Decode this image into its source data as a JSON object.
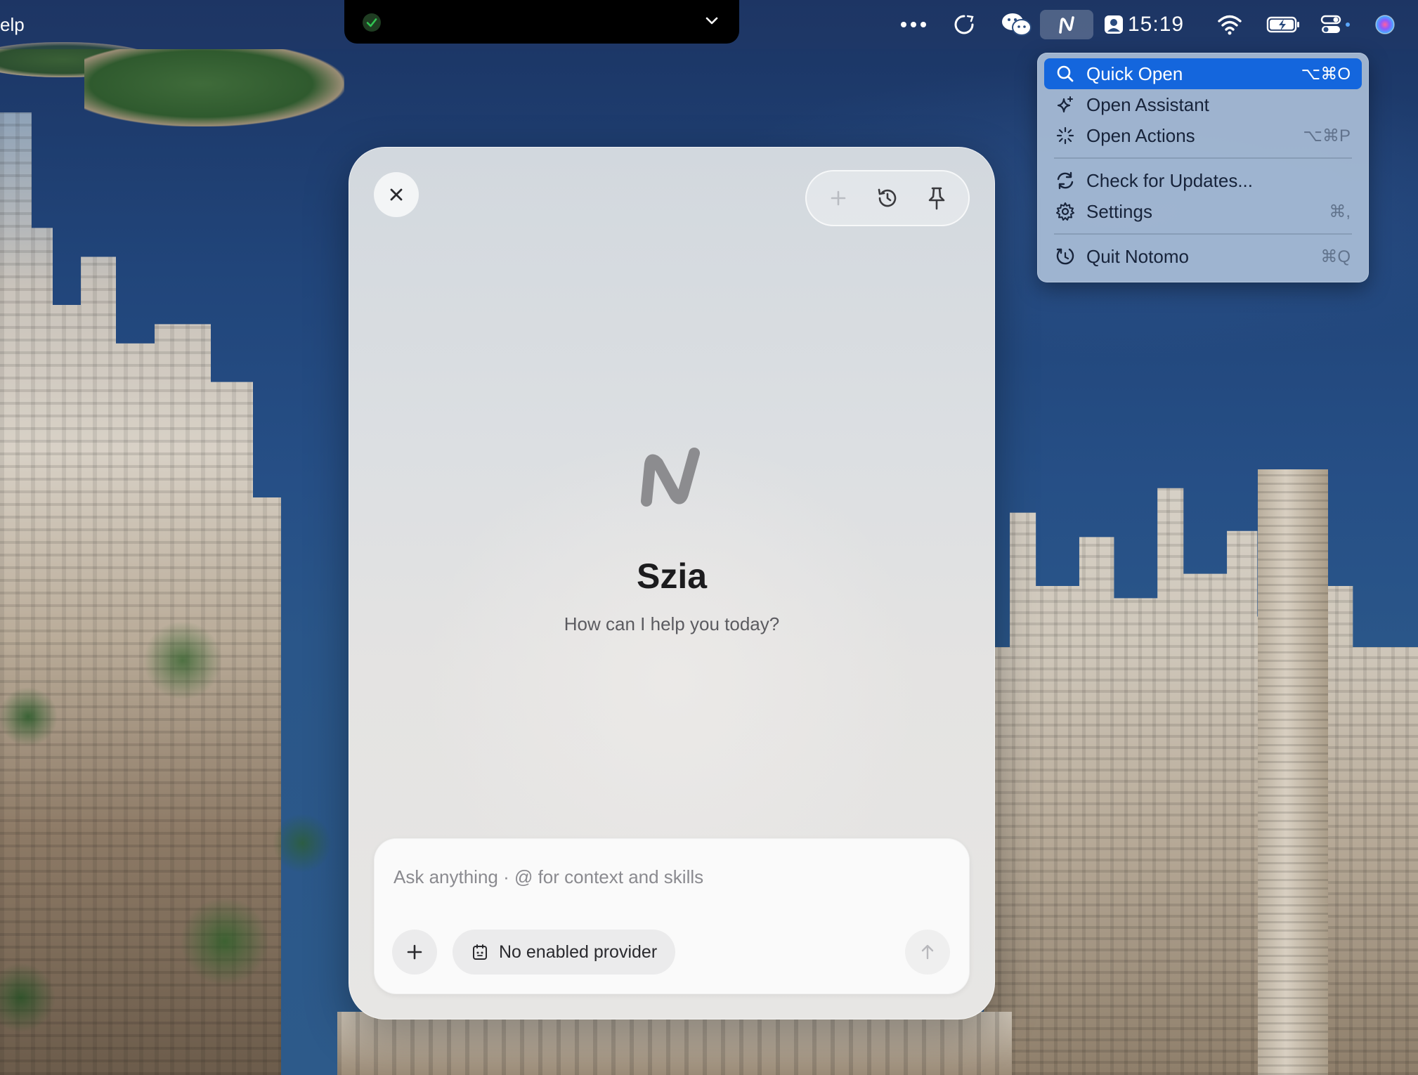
{
  "menubar": {
    "app_menu_partial": "elp",
    "clock": "15:19",
    "icons": [
      "overflow-dots-icon",
      "sync-icon",
      "wechat-icon",
      "notomo-icon",
      "user-accounts-icon",
      "wifi-icon",
      "battery-charging-icon",
      "control-center-icon",
      "siri-icon"
    ]
  },
  "notch": {
    "status_icon": "check-icon",
    "status_color": "#31c553"
  },
  "menu": {
    "items": [
      {
        "label": "Quick Open",
        "shortcut": "⌥⌘O",
        "icon": "search-icon",
        "selected": true
      },
      {
        "label": "Open Assistant",
        "shortcut": "",
        "icon": "sparkle-icon",
        "selected": false
      },
      {
        "label": "Open Actions",
        "shortcut": "⌥⌘P",
        "icon": "actions-icon",
        "selected": false
      },
      {
        "label": "Check for Updates...",
        "shortcut": "",
        "icon": "refresh-icon",
        "selected": false
      },
      {
        "label": "Settings",
        "shortcut": "⌘,",
        "icon": "gear-icon",
        "selected": false
      },
      {
        "label": "Quit Notomo",
        "shortcut": "⌘Q",
        "icon": "quit-icon",
        "selected": false
      }
    ],
    "selected_color": "#1466dd"
  },
  "panel": {
    "greeting": "Szia",
    "subtitle": "How can I help you today?",
    "composer": {
      "placeholder": "Ask anything · @ for context and skills",
      "provider_label": "No enabled provider"
    }
  }
}
